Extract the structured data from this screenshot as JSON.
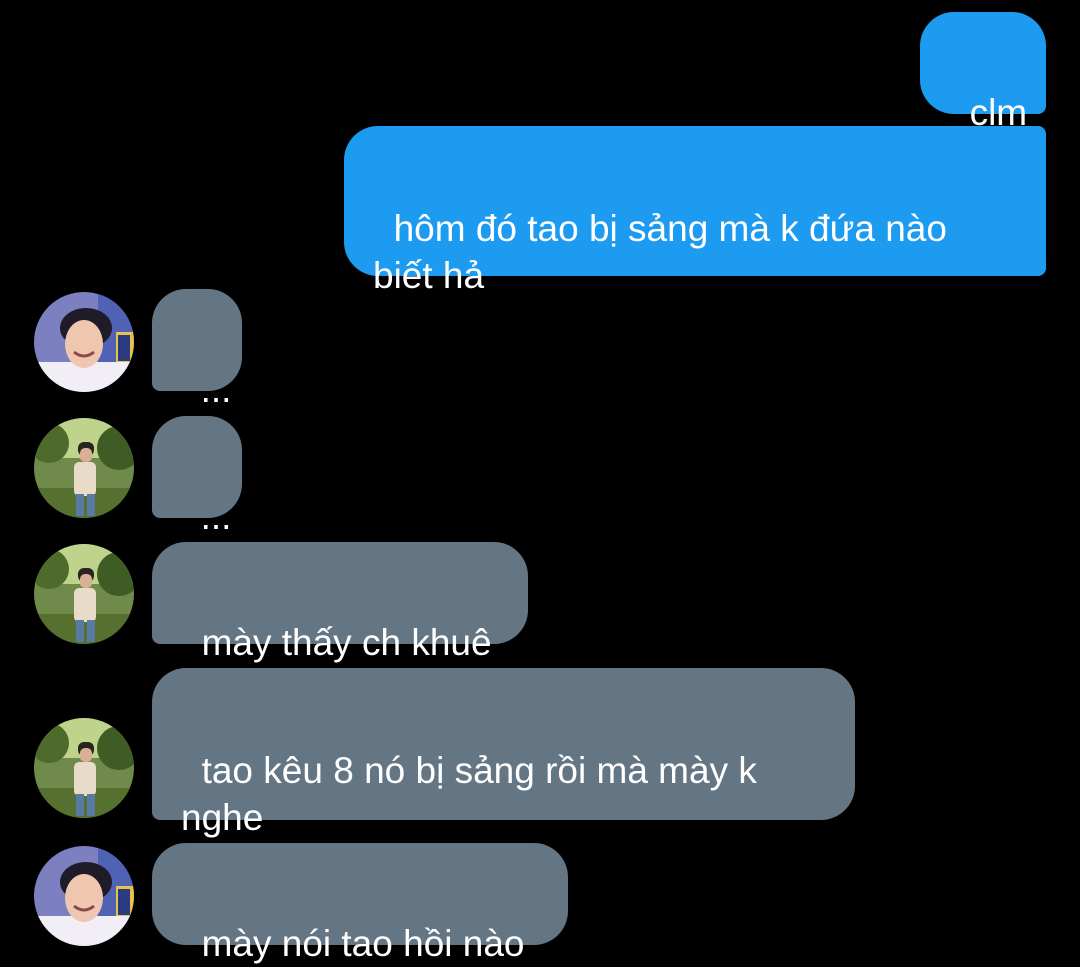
{
  "colors": {
    "background": "#000000",
    "outgoing_bubble": "#1d9bf0",
    "incoming_bubble": "#647584",
    "text": "#ffffff"
  },
  "messages": [
    {
      "direction": "outgoing",
      "text": "clm"
    },
    {
      "direction": "outgoing",
      "text": "hôm đó tao bị sảng mà k đứa nào biết hả"
    },
    {
      "direction": "incoming",
      "avatar": "avatar-portrait-icon",
      "text": "..."
    },
    {
      "direction": "incoming",
      "avatar": "avatar-outdoor-icon",
      "text": "..."
    },
    {
      "direction": "incoming",
      "avatar": "avatar-outdoor-icon",
      "text": "mày thấy ch khuê"
    },
    {
      "direction": "incoming",
      "avatar": "avatar-outdoor-icon",
      "text": "tao kêu 8 nó bị sảng rồi mà mày k nghe"
    },
    {
      "direction": "incoming",
      "avatar": "avatar-portrait-icon",
      "text": "mày nói tao hồi nào"
    }
  ]
}
